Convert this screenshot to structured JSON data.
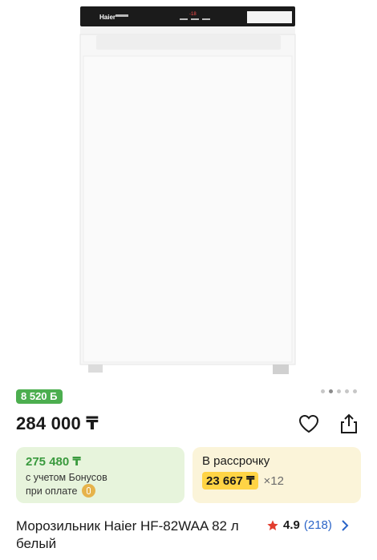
{
  "product": {
    "image_alt": "Haier freezer",
    "brand_on_image": "Haier",
    "bonus_badge": "8 520 Б",
    "price": "284 000 ₸",
    "bonus_card": {
      "price": "275 480 ₸",
      "line1": "с учетом Бонусов",
      "line2": "при оплате"
    },
    "credit_card": {
      "title": "В рассрочку",
      "monthly": "23 667 ₸",
      "months": "×12"
    },
    "title": "Морозильник Haier HF-82WAA 82 л белый",
    "rating": {
      "value": "4.9",
      "count": "(218)"
    }
  },
  "gallery": {
    "total": 5,
    "active": 1
  },
  "colors": {
    "green": "#4cae4f",
    "bonus_bg": "#e7f4dc",
    "credit_bg": "#fbf4d9",
    "highlight": "#ffd445",
    "star": "#e23d2e",
    "link": "#2a64c8"
  }
}
